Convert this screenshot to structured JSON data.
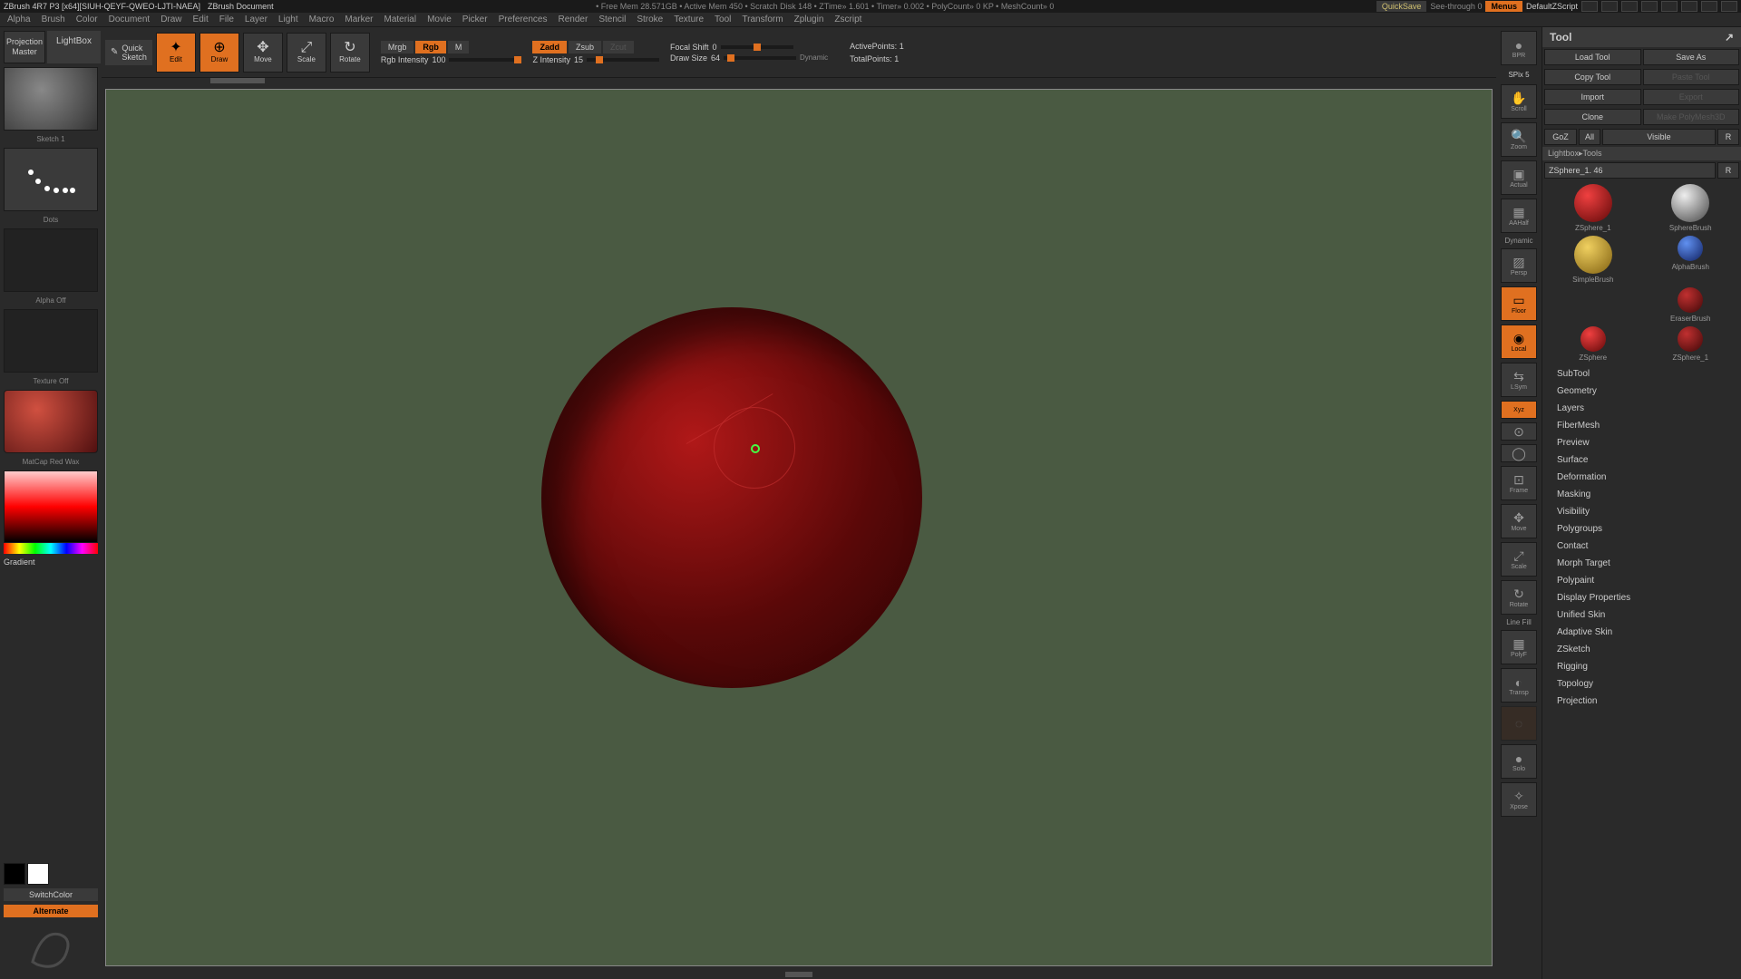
{
  "title": {
    "app": "ZBrush 4R7 P3 [x64][SIUH-QEYF-QWEO-LJTI-NAEA]",
    "doc": "ZBrush Document",
    "stats": "• Free Mem 28.571GB • Active Mem 450 • Scratch Disk 148 • ZTime» 1.601 • Timer» 0.002 • PolyCount» 0 KP • MeshCount» 0",
    "quicksave": "QuickSave",
    "see_through": "See-through  0",
    "menus": "Menus",
    "default_script": "DefaultZScript"
  },
  "menu": [
    "Alpha",
    "Brush",
    "Color",
    "Document",
    "Draw",
    "Edit",
    "File",
    "Layer",
    "Light",
    "Macro",
    "Marker",
    "Material",
    "Movie",
    "Picker",
    "Preferences",
    "Render",
    "Stencil",
    "Stroke",
    "Texture",
    "Tool",
    "Transform",
    "Zplugin",
    "Zscript"
  ],
  "left": {
    "projection_master": "Projection\nMaster",
    "lightbox": "LightBox",
    "sketch_label": "Sketch 1",
    "dots_label": "Dots",
    "alpha_label": "Alpha Off",
    "texture_label": "Texture Off",
    "material_label": "MatCap Red Wax",
    "gradient": "Gradient",
    "switch_color": "SwitchColor",
    "alternate": "Alternate"
  },
  "shelf": {
    "quick_sketch": "Quick\nSketch",
    "edit": "Edit",
    "draw": "Draw",
    "move": "Move",
    "scale": "Scale",
    "rotate": "Rotate",
    "mrgb": "Mrgb",
    "rgb": "Rgb",
    "m": "M",
    "rgb_intensity_lbl": "Rgb Intensity",
    "rgb_intensity_val": "100",
    "zadd": "Zadd",
    "zsub": "Zsub",
    "zcut": "Zcut",
    "z_intensity_lbl": "Z Intensity",
    "z_intensity_val": "15",
    "focal_shift_lbl": "Focal Shift",
    "focal_shift_val": "0",
    "draw_size_lbl": "Draw Size",
    "draw_size_val": "64",
    "dynamic": "Dynamic",
    "active_points_lbl": "ActivePoints:",
    "active_points_val": "1",
    "total_points_lbl": "TotalPoints:",
    "total_points_val": "1"
  },
  "right_shelf": {
    "spix": "SPix 5",
    "items": [
      {
        "label": "BPR",
        "name": "bpr"
      },
      {
        "label": "Scroll",
        "name": "scroll"
      },
      {
        "label": "Zoom",
        "name": "zoom"
      },
      {
        "label": "Actual",
        "name": "actual"
      },
      {
        "label": "AAHalf",
        "name": "aahalf"
      },
      {
        "label": "Persp",
        "name": "persp",
        "sub": "Dynamic"
      },
      {
        "label": "Floor",
        "name": "floor",
        "active": true
      },
      {
        "label": "Local",
        "name": "local",
        "active": true
      },
      {
        "label": "LSym",
        "name": "lsym"
      },
      {
        "label": "Xyz",
        "name": "xyz",
        "active": true
      },
      {
        "label": "",
        "name": "center"
      },
      {
        "label": "",
        "name": "fit"
      },
      {
        "label": "Frame",
        "name": "frame"
      },
      {
        "label": "Move",
        "name": "move-view"
      },
      {
        "label": "Scale",
        "name": "scale-view"
      },
      {
        "label": "Rotate",
        "name": "rotate-view"
      },
      {
        "label": "PolyF",
        "name": "polyf",
        "sub": "Line Fill"
      },
      {
        "label": "Transp",
        "name": "transp"
      },
      {
        "label": "",
        "name": "ghost",
        "dim": true
      },
      {
        "label": "Solo",
        "name": "solo"
      },
      {
        "label": "Xpose",
        "name": "xpose"
      }
    ]
  },
  "tool": {
    "header": "Tool",
    "load": "Load Tool",
    "save": "Save As",
    "copy": "Copy Tool",
    "paste": "Paste Tool",
    "import": "Import",
    "export": "Export",
    "clone": "Clone",
    "make_polymesh": "Make PolyMesh3D",
    "goz": "GoZ",
    "all": "All",
    "visible": "Visible",
    "r": "R",
    "lightbox_tools": "Lightbox▸Tools",
    "current": "ZSphere_1. 46",
    "tools": [
      {
        "name": "ZSphere_1",
        "style": "ball-red"
      },
      {
        "name": "SphereBrush",
        "style": "ball-grey"
      },
      {
        "name": "AlphaBrush",
        "style": "ball-blue"
      },
      {
        "name": "SimpleBrush",
        "style": "ball-gold"
      },
      {
        "name": "EraserBrush",
        "style": "ball-dkred"
      },
      {
        "name": "ZSphere",
        "style": "ball-red"
      },
      {
        "name": "ZSphere_1",
        "style": "ball-dkred"
      }
    ],
    "subs": [
      "SubTool",
      "Geometry",
      "Layers",
      "FiberMesh",
      "Preview",
      "Surface",
      "Deformation",
      "Masking",
      "Visibility",
      "Polygroups",
      "Contact",
      "Morph Target",
      "Polypaint",
      "Display Properties",
      "Unified Skin",
      "Adaptive Skin",
      "ZSketch",
      "Rigging",
      "Topology",
      "Projection"
    ]
  }
}
